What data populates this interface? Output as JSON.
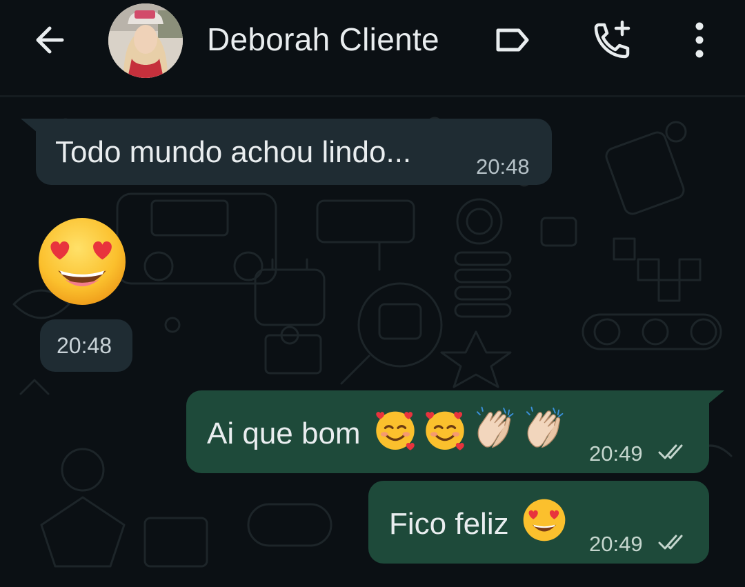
{
  "header": {
    "back_icon": "arrow-left-icon",
    "contact_name": "Deborah Cliente",
    "label_icon": "label-tag-icon",
    "call_icon": "add-call-icon",
    "menu_icon": "more-vertical-icon"
  },
  "messages": [
    {
      "direction": "incoming",
      "text": "Todo mundo achou lindo...",
      "time": "20:48"
    },
    {
      "direction": "incoming",
      "emoji": "heart-eyes-emoji",
      "time": "20:48"
    },
    {
      "direction": "outgoing",
      "text": "Ai que bom",
      "emojis": [
        "smiling-face-with-hearts-emoji",
        "smiling-face-with-hearts-emoji",
        "clapping-hands-emoji",
        "clapping-hands-emoji"
      ],
      "time": "20:49",
      "status": "read-double-check"
    },
    {
      "direction": "outgoing",
      "text": "Fico feliz",
      "emojis": [
        "heart-eyes-emoji"
      ],
      "time": "20:49",
      "status": "read-double-check"
    }
  ],
  "colors": {
    "background": "#0b1014",
    "incoming_bubble": "#1f2c33",
    "outgoing_bubble": "#1e4a3a",
    "text": "#e9edef"
  }
}
